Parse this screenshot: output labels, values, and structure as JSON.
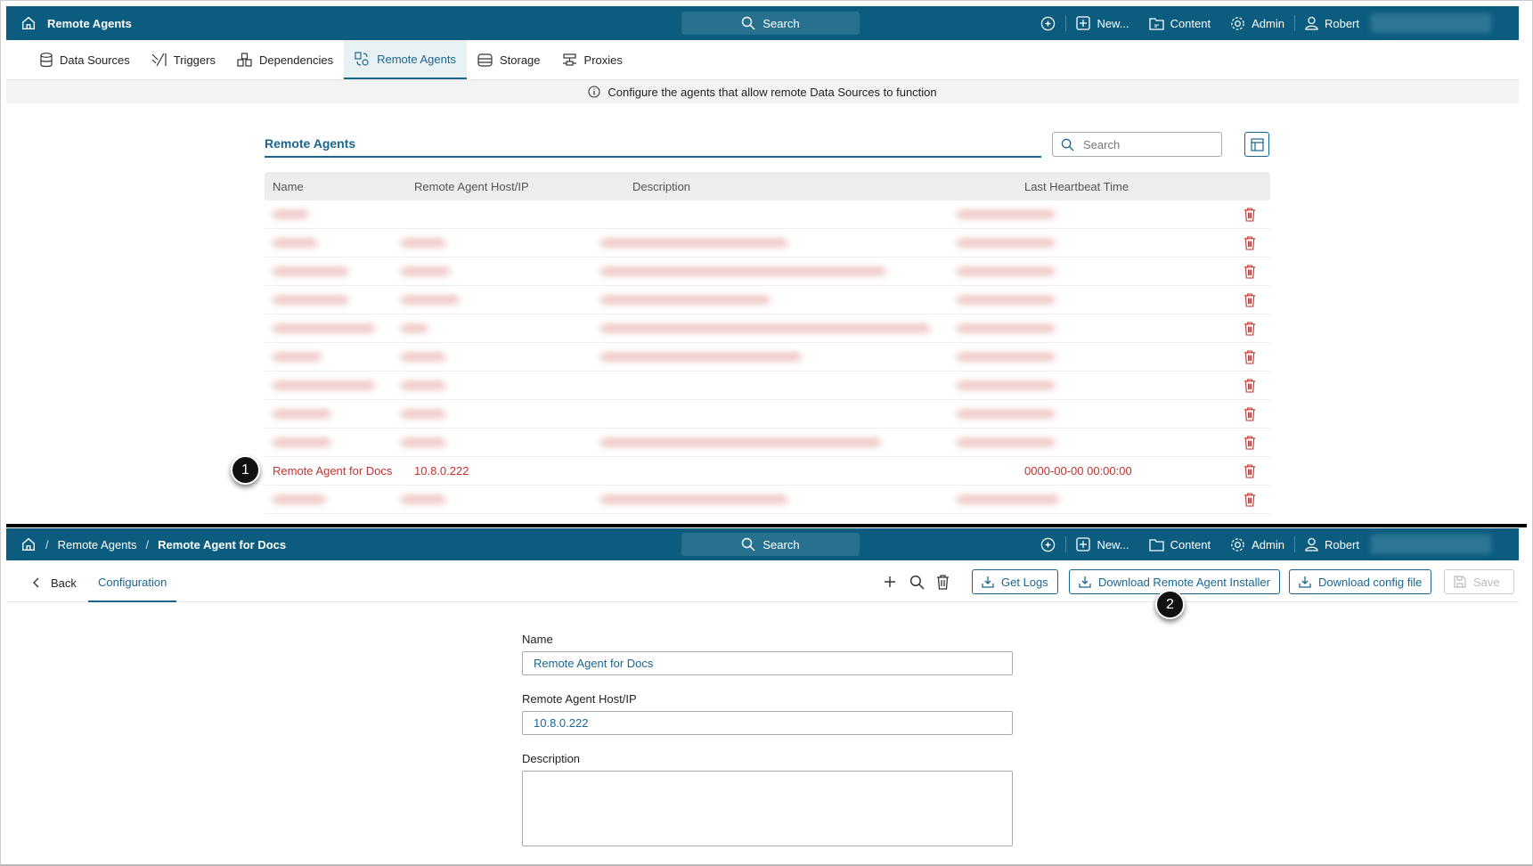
{
  "top_header": {
    "title": "Remote Agents",
    "search": "Search",
    "new": "New...",
    "content": "Content",
    "admin": "Admin",
    "user": "Robert"
  },
  "tabs": [
    {
      "label": "Data Sources"
    },
    {
      "label": "Triggers"
    },
    {
      "label": "Dependencies"
    },
    {
      "label": "Remote Agents"
    },
    {
      "label": "Storage"
    },
    {
      "label": "Proxies"
    }
  ],
  "info": "Configure the agents that allow remote Data Sources to function",
  "list": {
    "title": "Remote Agents",
    "search_placeholder": "Search",
    "columns": [
      "Name",
      "Remote Agent Host/IP",
      "Description",
      "Last Heartbeat Time"
    ],
    "highlight_row": {
      "name": "Remote Agent for Docs",
      "host": "10.8.0.222",
      "description": "",
      "heartbeat": "0000-00-00 00:00:00"
    }
  },
  "callouts": [
    "1",
    "2"
  ],
  "detail_header": {
    "crumb1": "Remote Agents",
    "sep": "/",
    "crumb2": "Remote Agent for Docs",
    "search": "Search",
    "new": "New...",
    "content": "Content",
    "admin": "Admin",
    "user": "Robert"
  },
  "toolbar": {
    "back": "Back",
    "tab": "Configuration",
    "get_logs": "Get Logs",
    "download_installer": "Download Remote Agent Installer",
    "download_config": "Download config file",
    "save": "Save"
  },
  "form": {
    "name_label": "Name",
    "name_value": "Remote Agent for Docs",
    "host_label": "Remote Agent Host/IP",
    "host_value": "10.8.0.222",
    "desc_label": "Description",
    "desc_value": ""
  },
  "colors": {
    "header": "#0b5c7e",
    "accent": "#1a6690",
    "danger": "#c2332f"
  }
}
